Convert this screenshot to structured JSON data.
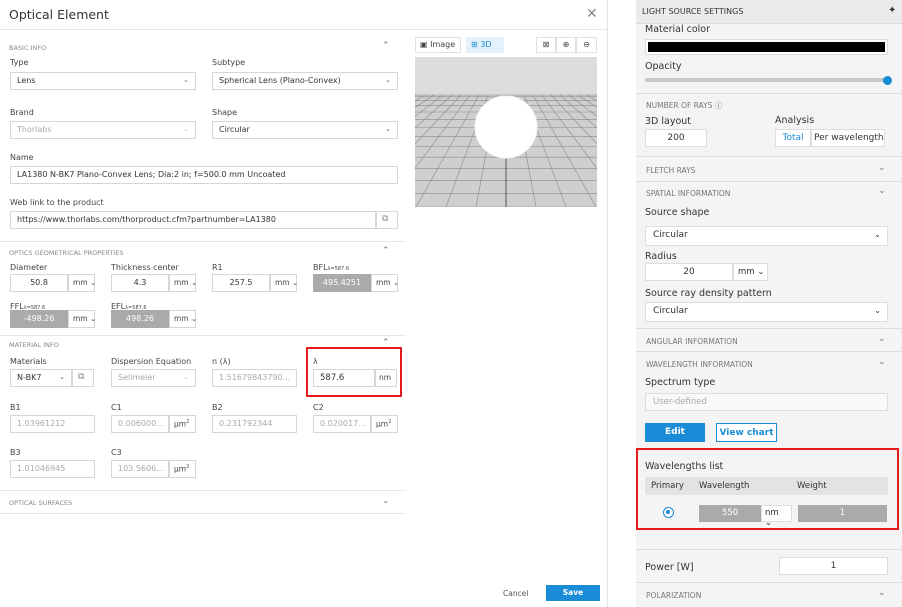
{
  "dialog": {
    "title": "Optical Element",
    "close": "✕",
    "basic_info": {
      "section": "BASIC INFO",
      "type_label": "Type",
      "type_value": "Lens",
      "subtype_label": "Subtype",
      "subtype_value": "Spherical Lens (Plano-Convex)",
      "brand_label": "Brand",
      "brand_value": "Thorlabs",
      "shape_label": "Shape",
      "shape_value": "Circular",
      "name_label": "Name",
      "name_value": "LA1380 N-BK7 Plano-Convex Lens; Dia:2 in; f=500.0 mm Uncoated",
      "weblink_label": "Web link to the product",
      "weblink_value": "https://www.thorlabs.com/thorproduct.cfm?partnumber=LA1380"
    },
    "geom": {
      "section": "OPTICS GEOMETRICAL PROPERTIES",
      "diameter_label": "Diameter",
      "diameter_value": "50.8",
      "diameter_unit": "mm",
      "thickness_label": "Thickness center",
      "thickness_value": "4.3",
      "thickness_unit": "mm",
      "r1_label": "R1",
      "r1_value": "257.5",
      "r1_unit": "mm",
      "bfl_label": "BFL",
      "bfl_sub": "λ=587.6",
      "bfl_value": "495.4251",
      "bfl_unit": "mm",
      "ffl_label": "FFL",
      "ffl_sub": "λ=587.6",
      "ffl_value": "-498.26",
      "ffl_unit": "mm",
      "efl_label": "EFL",
      "efl_sub": "λ=587.6",
      "efl_value": "498.26",
      "efl_unit": "mm"
    },
    "material": {
      "section": "MATERIAL INFO",
      "materials_label": "Materials",
      "materials_value": "N-BK7",
      "dispersion_label": "Dispersion Equation",
      "dispersion_value": "Sellmeier",
      "n_label": "n (λ)",
      "n_value": "1.51679843790...",
      "lambda_label": "λ",
      "lambda_value": "587.6",
      "lambda_unit": "nm",
      "b1_label": "B1",
      "b1_value": "1.03961212",
      "c1_label": "C1",
      "c1_value": "0.006000...",
      "c1_unit": "μm",
      "b2_label": "B2",
      "b2_value": "0.231792344",
      "c2_label": "C2",
      "c2_value": "0.020017...",
      "c2_unit": "μm",
      "b3_label": "B3",
      "b3_value": "1.01046945",
      "c3_label": "C3",
      "c3_value": "103.5606...",
      "c3_unit": "μm",
      "unit_sup": "2"
    },
    "surfaces": {
      "section": "OPTICAL SURFACES"
    },
    "preview": {
      "image_tab": "Image",
      "threed_tab": "3D"
    },
    "footer": {
      "cancel": "Cancel",
      "save": "Save"
    }
  },
  "panel": {
    "title": "LIGHT SOURCE SETTINGS",
    "material_color_label": "Material color",
    "opacity_label": "Opacity",
    "opacity_level": 1.0,
    "rays_section": "NUMBER OF RAYS",
    "layout_label": "3D layout",
    "layout_value": "200",
    "analysis_label": "Analysis",
    "analysis_total": "Total",
    "analysis_per_wavelength": "Per wavelength",
    "fletch_section": "FLETCH RAYS",
    "spatial_section": "SPATIAL INFORMATION",
    "source_shape_label": "Source shape",
    "source_shape_value": "Circular",
    "radius_label": "Radius",
    "radius_value": "20",
    "radius_unit": "mm",
    "density_label": "Source ray density pattern",
    "density_value": "Circular",
    "angular_section": "ANGULAR INFORMATION",
    "wavelength_section": "WAVELENGTH INFORMATION",
    "spectrum_label": "Spectrum type",
    "spectrum_placeholder": "User-defined",
    "edit_btn": "Edit",
    "view_chart_btn": "View chart",
    "wl_list_label": "Wavelengths list",
    "col_primary": "Primary",
    "col_wavelength": "Wavelength",
    "col_weight": "Weight",
    "wl_value": "550",
    "wl_unit": "nm",
    "weight_value": "1",
    "power_label": "Power [W]",
    "power_value": "1",
    "polarization_section": "POLARIZATION"
  }
}
